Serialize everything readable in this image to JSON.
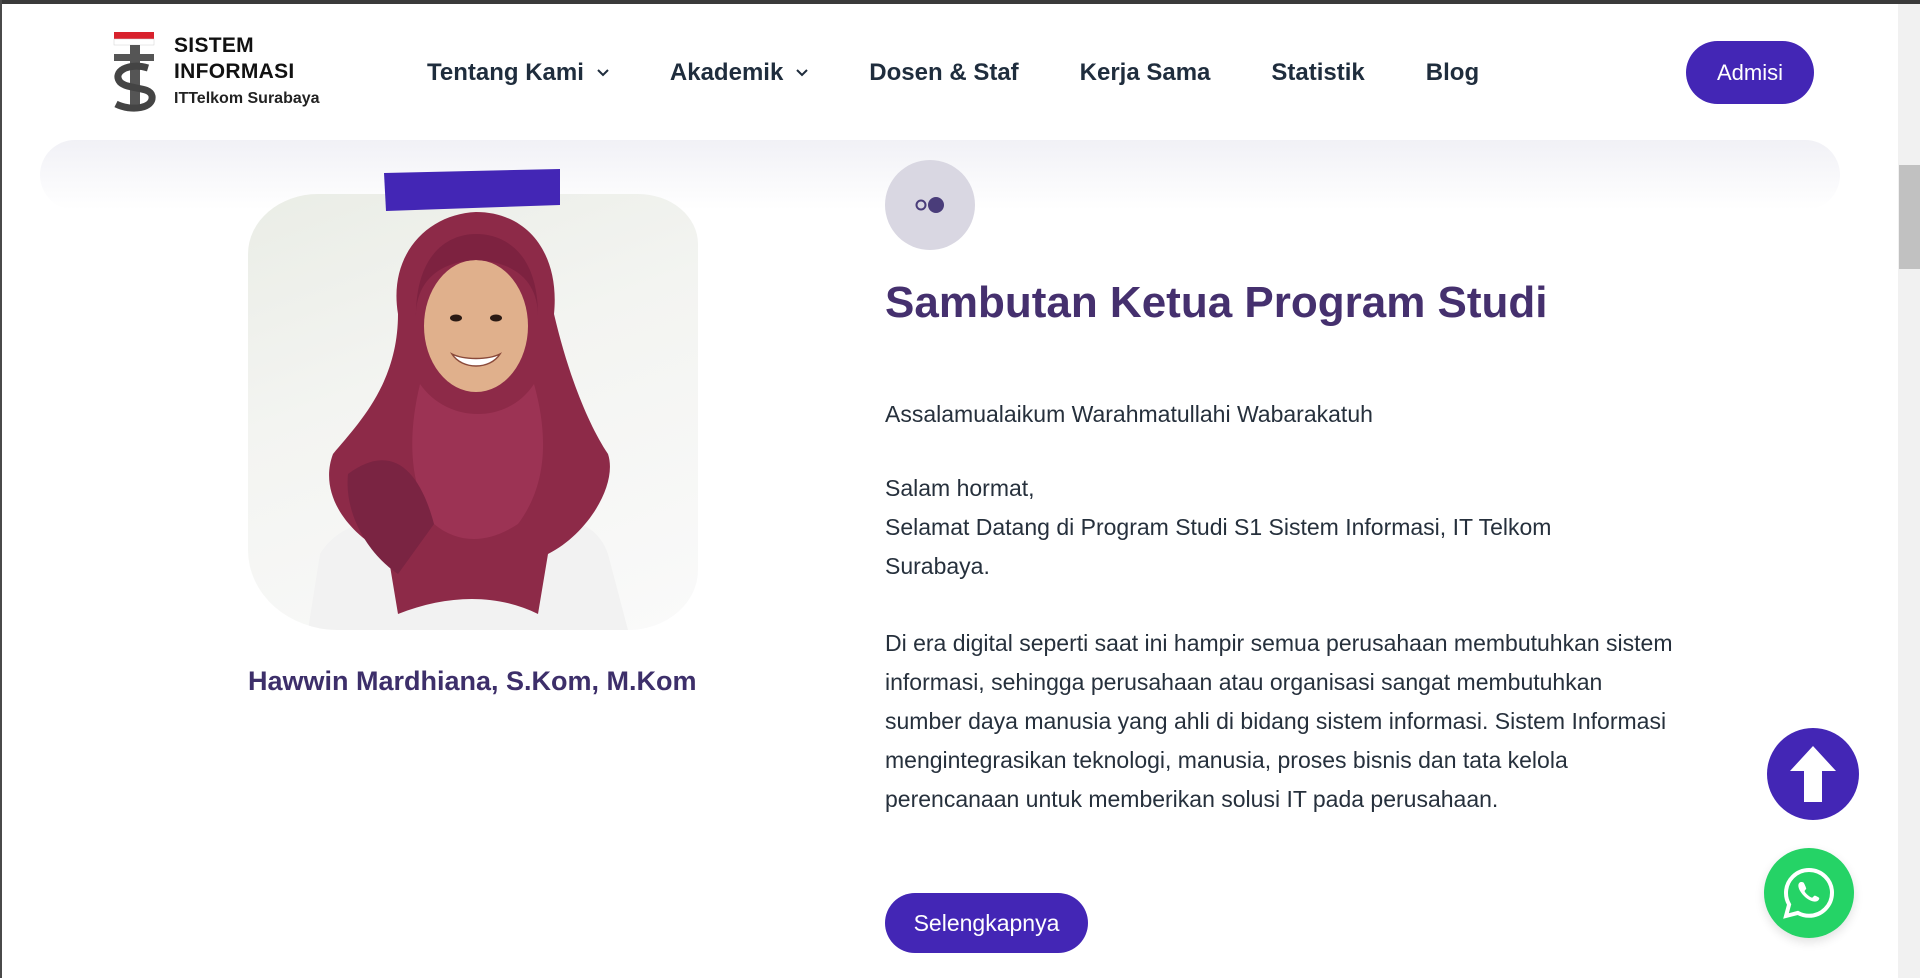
{
  "header": {
    "logo": {
      "line1": "SISTEM",
      "line2": "INFORMASI",
      "line3": "ITTelkom Surabaya"
    },
    "nav": [
      {
        "label": "Tentang Kami",
        "has_dropdown": true
      },
      {
        "label": "Akademik",
        "has_dropdown": true
      },
      {
        "label": "Dosen & Staf",
        "has_dropdown": false
      },
      {
        "label": "Kerja Sama",
        "has_dropdown": false
      },
      {
        "label": "Statistik",
        "has_dropdown": false
      },
      {
        "label": "Blog",
        "has_dropdown": false
      }
    ],
    "cta_label": "Admisi"
  },
  "profile": {
    "name": "Hawwin Mardhiana, S.Kom, M.Kom"
  },
  "welcome": {
    "icon": "quote-icon",
    "title": "Sambutan Ketua Program Studi",
    "greeting": "Assalamualaikum Warahmatullahi Wabarakatuh",
    "salam_line1": "Salam hormat,",
    "salam_line2": "Selamat Datang di Program Studi S1 Sistem Informasi, IT Telkom",
    "salam_line3": "Surabaya.",
    "body": "Di era digital seperti saat ini hampir semua perusahaan membutuhkan sistem informasi, sehingga perusahaan atau organisasi sangat membutuhkan sumber daya manusia yang ahli di bidang sistem informasi. Sistem Informasi mengintegrasikan teknologi, manusia, proses bisnis dan tata kelola perencanaan untuk memberikan solusi IT pada perusahaan.",
    "more_label": "Selengkapnya"
  },
  "floating": {
    "scroll_top_icon": "arrow-up-icon",
    "whatsapp_icon": "whatsapp-icon"
  },
  "colors": {
    "primary": "#4326b5",
    "title": "#45306e",
    "whatsapp": "#25d366"
  }
}
